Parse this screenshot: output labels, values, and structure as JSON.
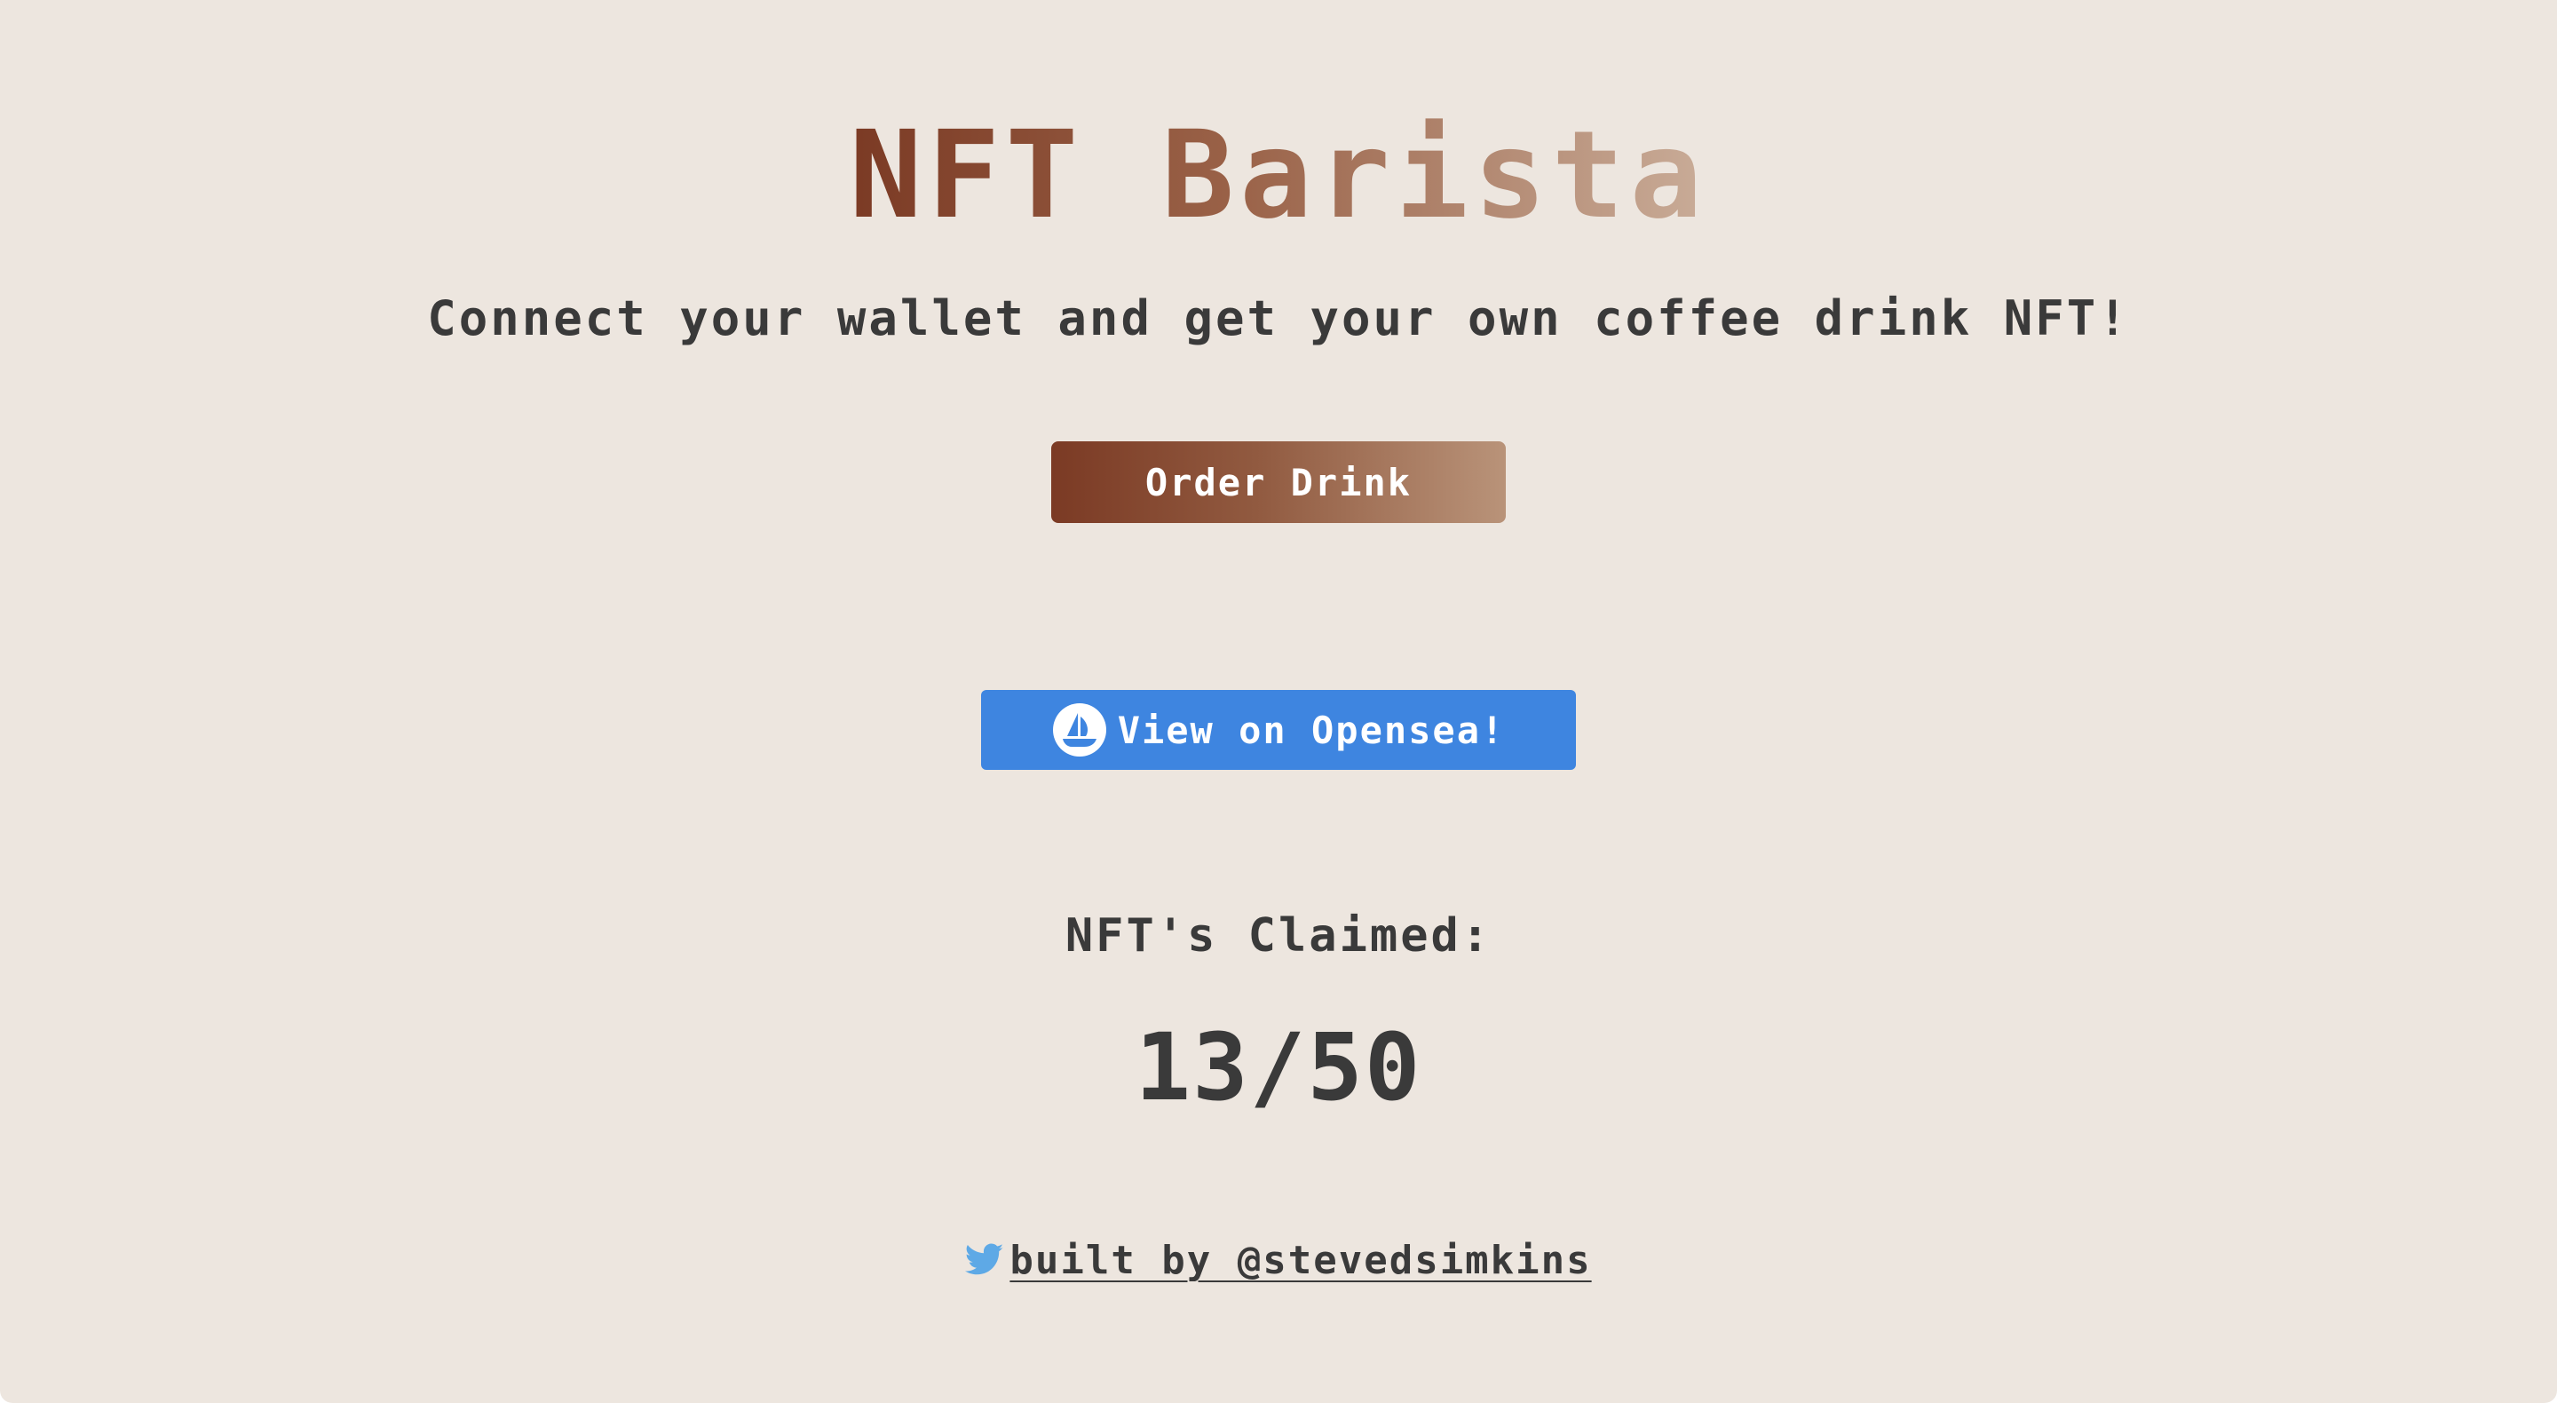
{
  "header": {
    "title": "NFT Barista",
    "subtitle": "Connect your wallet and get your own coffee drink NFT!"
  },
  "actions": {
    "order_label": "Order Drink",
    "opensea_label": "View on Opensea!",
    "opensea_icon": "opensea-boat-icon"
  },
  "stats": {
    "claimed_label": "NFT's Claimed:",
    "claimed_count": "13/50"
  },
  "footer": {
    "credit": "built by @stevedsimkins",
    "icon": "twitter-bird-icon"
  },
  "colors": {
    "background": "#ede6df",
    "accent_brown": "#7b3a24",
    "opensea_blue": "#3e85e0",
    "twitter_blue": "#5ea9e6",
    "text": "#3a3a3a"
  }
}
